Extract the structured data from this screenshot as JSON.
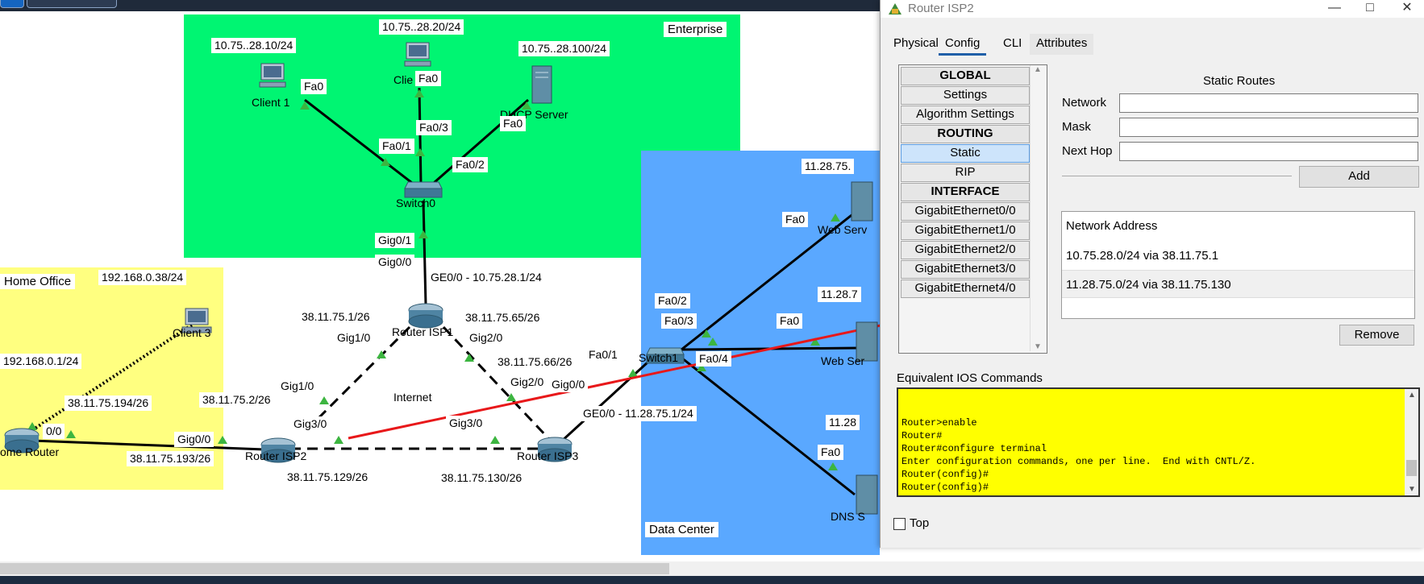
{
  "canvas": {
    "areas": {
      "enterprise": "Enterprise",
      "home_office": "Home Office",
      "data_center": "Data Center",
      "internet": "Internet"
    },
    "colors": {
      "enterprise": "#00f572",
      "home_office": "#ffff80",
      "data_center": "#5aa8ff",
      "link_red": "#e8181a"
    },
    "devices": {
      "client1": "Client 1",
      "client2": "Clie",
      "dhcp_server": "DHCP Server",
      "switch0": "Switch0",
      "router_isp1": "Router ISP1",
      "router_isp2": "Router ISP2",
      "router_isp3": "Router ISP3",
      "switch1": "Switch1",
      "home_router": "ome Router",
      "client3": "Client 3",
      "web_server1": "Web Serv",
      "web_server2": "Web Ser",
      "dns_server": "DNS S"
    },
    "labels": {
      "client1_ip": "10.75..28.10/24",
      "client2_ip": "10.75..28.20/24",
      "dhcp_ip": "10.75..28.100/24",
      "fa0_c1": "Fa0",
      "fa0_c2": "Fa0",
      "fa0_dhcp": "Fa0",
      "fa0_3": "Fa0/3",
      "fa0_1": "Fa0/1",
      "fa0_2": "Fa0/2",
      "gig0_1": "Gig0/1",
      "gig0_0_sw": "Gig0/0",
      "ge0_0_isp1": "GE0/0 - 10.75.28.1/24",
      "isp1_left_ip": "38.11.75.1/26",
      "isp1_right_ip": "38.11.75.65/26",
      "gig1_0_isp1": "Gig1/0",
      "gig2_0_isp1": "Gig2/0",
      "isp3_top_ip": "38.11.75.66/26",
      "gig2_0_isp3": "Gig2/0",
      "gig0_0_isp3": "Gig0/0",
      "fa0_1_sw1": "Fa0/1",
      "ge0_0_isp3": "GE0/0 - 11.28.75.1/24",
      "gig1_0_isp2": "Gig1/0",
      "isp2_left_ip": "38.11.75.2/26",
      "gig3_0_isp2": "Gig3/0",
      "gig3_0_isp3": "Gig3/0",
      "gig0_0_isp2": "Gig0/0",
      "isp2_bottom_ip": "38.11.75.129/26",
      "isp3_bottom_ip": "38.11.75.130/26",
      "home_ip1": "38.11.75.194/26",
      "home_ip2": "38.11.75.193/26",
      "home_port": "0/0",
      "home_lan_ip": "192.168.0.1/24",
      "client3_ip": "192.168.0.38/24",
      "web1_ip": "11.28.75.",
      "web2_ip": "11.28.7",
      "dns_ip": "11.28",
      "fa0_web1": "Fa0",
      "fa0_web2": "Fa0",
      "fa0_dns": "Fa0",
      "fa0_2_sw1": "Fa0/2",
      "fa0_3_sw1": "Fa0/3",
      "fa0_4_sw1": "Fa0/4"
    }
  },
  "dialog": {
    "title": "Router ISP2",
    "tabs": [
      "Physical",
      "Config",
      "CLI",
      "Attributes"
    ],
    "active_tab": "Config",
    "panel_items": [
      {
        "label": "GLOBAL",
        "header": true
      },
      {
        "label": "Settings"
      },
      {
        "label": "Algorithm Settings"
      },
      {
        "label": "ROUTING",
        "header": true
      },
      {
        "label": "Static",
        "selected": true
      },
      {
        "label": "RIP"
      },
      {
        "label": "INTERFACE",
        "header": true
      },
      {
        "label": "GigabitEthernet0/0"
      },
      {
        "label": "GigabitEthernet1/0"
      },
      {
        "label": "GigabitEthernet2/0"
      },
      {
        "label": "GigabitEthernet3/0"
      },
      {
        "label": "GigabitEthernet4/0"
      }
    ],
    "static_routes": {
      "heading": "Static Routes",
      "network_label": "Network",
      "mask_label": "Mask",
      "next_hop_label": "Next Hop",
      "network_value": "",
      "mask_value": "",
      "next_hop_value": "",
      "add_label": "Add",
      "list_header": "Network Address",
      "routes": [
        "10.75.28.0/24 via 38.11.75.1",
        "11.28.75.0/24 via 38.11.75.130"
      ],
      "remove_label": "Remove"
    },
    "ios_heading": "Equivalent IOS Commands",
    "ios_lines": "Router>enable\nRouter#\nRouter#configure terminal\nEnter configuration commands, one per line.  End with CNTL/Z.\nRouter(config)#\nRouter(config)#",
    "top_label": "Top",
    "top_checked": false
  }
}
